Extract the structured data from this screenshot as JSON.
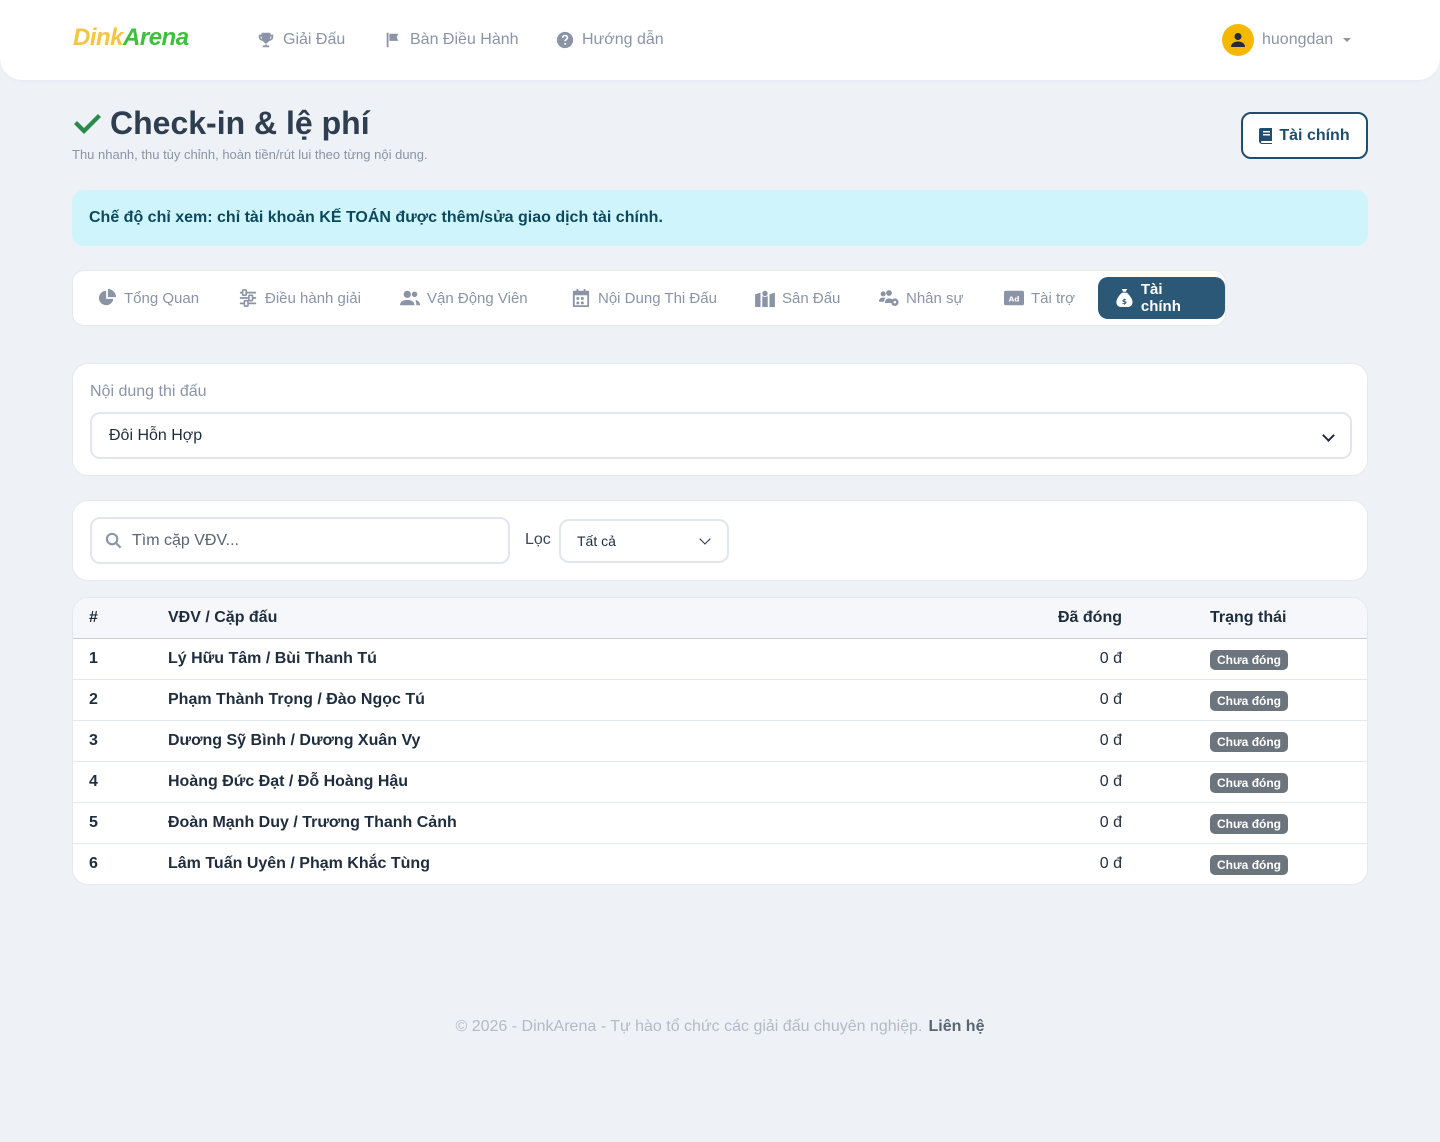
{
  "brand": {
    "part1": "Dink",
    "part2": "Arena"
  },
  "nav": {
    "items": [
      {
        "label": "Giải Đấu",
        "icon": "trophy-icon"
      },
      {
        "label": "Bàn Điều Hành",
        "icon": "flag-icon"
      },
      {
        "label": "Hướng dẫn",
        "icon": "question-circle-icon"
      }
    ],
    "username": "huongdan"
  },
  "header": {
    "title": "Check-in & lệ phí",
    "subtitle": "Thu nhanh, thu tùy chỉnh, hoàn tiền/rút lui theo từng nội dung.",
    "finance_button": "Tài chính"
  },
  "alert": {
    "text": "Chế độ chỉ xem: chỉ tài khoản KẾ TOÁN được thêm/sửa giao dịch tài chính."
  },
  "tabs": [
    {
      "label": "Tổng Quan",
      "icon": "chart-pie-icon"
    },
    {
      "label": "Điều hành giải",
      "icon": "sliders-icon"
    },
    {
      "label": "Vận Động Viên",
      "icon": "users-icon"
    },
    {
      "label": "Nội Dung Thi Đấu",
      "icon": "calendar-icon"
    },
    {
      "label": "Sân Đấu",
      "icon": "map-location-icon"
    },
    {
      "label": "Nhân sự",
      "icon": "users-gear-icon"
    },
    {
      "label": "Tài trợ",
      "icon": "rectangle-ad-icon"
    },
    {
      "label": "Tài chính",
      "icon": "money-bag-icon",
      "active": true
    }
  ],
  "event_select": {
    "label": "Nội dung thi đấu",
    "value": "Đôi Hỗn Hợp"
  },
  "filters": {
    "search_placeholder": "Tìm cặp VĐV...",
    "filter_label": "Lọc",
    "filter_value": "Tất cả"
  },
  "table": {
    "headers": {
      "idx": "#",
      "name": "VĐV / Cặp đấu",
      "paid": "Đã đóng",
      "status": "Trạng thái"
    },
    "rows": [
      {
        "idx": "1",
        "name": "Lý Hữu Tâm / Bùi Thanh Tú",
        "paid": "0 đ",
        "status": "Chưa đóng"
      },
      {
        "idx": "2",
        "name": "Phạm Thành Trọng / Đào Ngọc Tú",
        "paid": "0 đ",
        "status": "Chưa đóng"
      },
      {
        "idx": "3",
        "name": "Dương Sỹ Bình / Dương Xuân Vy",
        "paid": "0 đ",
        "status": "Chưa đóng"
      },
      {
        "idx": "4",
        "name": "Hoàng Đức Đạt / Đỗ Hoàng Hậu",
        "paid": "0 đ",
        "status": "Chưa đóng"
      },
      {
        "idx": "5",
        "name": "Đoàn Mạnh Duy / Trương Thanh Cảnh",
        "paid": "0 đ",
        "status": "Chưa đóng"
      },
      {
        "idx": "6",
        "name": "Lâm Tuấn Uyên / Phạm Khắc Tùng",
        "paid": "0 đ",
        "status": "Chưa đóng"
      }
    ]
  },
  "footer": {
    "text": "© 2026 - DinkArena - Tự hào tổ chức các giải đấu chuyên nghiệp.",
    "link": "Liên hệ"
  },
  "colors": {
    "accent": "#2b5876",
    "badge": "#6c757d",
    "alert_bg": "#cff4fc",
    "check": "#2a8a4a"
  }
}
